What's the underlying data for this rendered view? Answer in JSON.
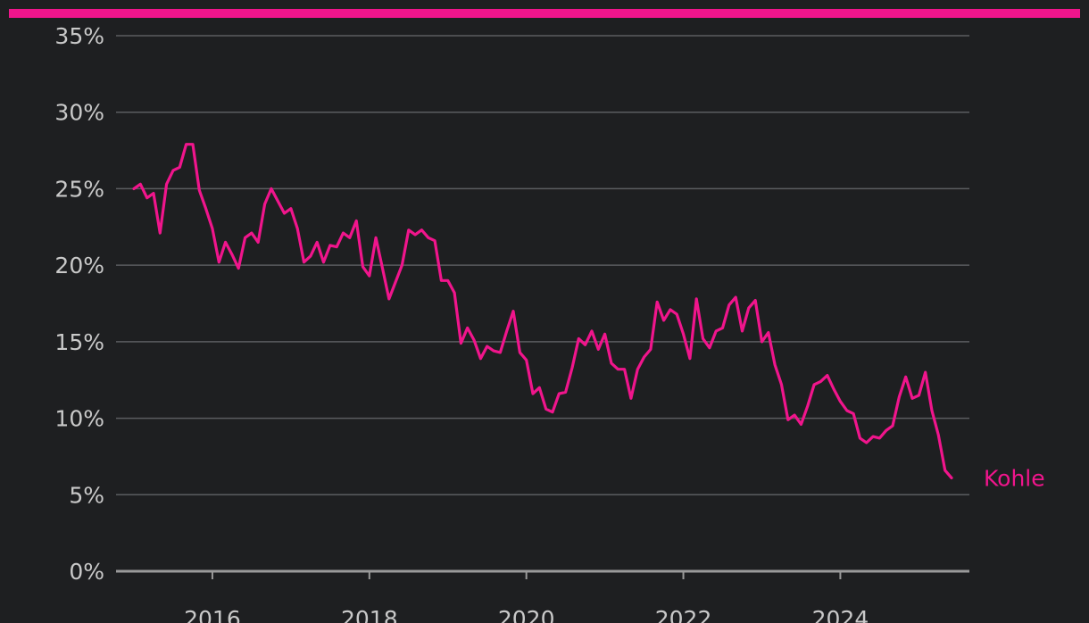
{
  "colors": {
    "background": "#1e1f21",
    "accent": "#f0158c",
    "grid": "#5b5d60",
    "baseline": "#9a9a9a",
    "tick_text": "#c9c9c9"
  },
  "chart_data": {
    "type": "line",
    "title": "",
    "xlabel": "",
    "ylabel": "",
    "ylim": [
      0,
      35
    ],
    "xlim": [
      "2015-01",
      "2025-06"
    ],
    "y_ticks": [
      "0%",
      "5%",
      "10%",
      "15%",
      "20%",
      "25%",
      "30%",
      "35%"
    ],
    "x_ticks": [
      "2016",
      "2018",
      "2020",
      "2022",
      "2024"
    ],
    "grid": true,
    "legend": "direct label at line end",
    "series": [
      {
        "name": "Kohle",
        "x": [
          "2015-01",
          "2015-02",
          "2015-03",
          "2015-04",
          "2015-05",
          "2015-06",
          "2015-07",
          "2015-08",
          "2015-09",
          "2015-10",
          "2015-11",
          "2015-12",
          "2016-01",
          "2016-02",
          "2016-03",
          "2016-04",
          "2016-05",
          "2016-06",
          "2016-07",
          "2016-08",
          "2016-09",
          "2016-10",
          "2016-11",
          "2016-12",
          "2017-01",
          "2017-02",
          "2017-03",
          "2017-04",
          "2017-05",
          "2017-06",
          "2017-07",
          "2017-08",
          "2017-09",
          "2017-10",
          "2017-11",
          "2017-12",
          "2018-01",
          "2018-02",
          "2018-03",
          "2018-04",
          "2018-05",
          "2018-06",
          "2018-07",
          "2018-08",
          "2018-09",
          "2018-10",
          "2018-11",
          "2018-12",
          "2019-01",
          "2019-02",
          "2019-03",
          "2019-04",
          "2019-05",
          "2019-06",
          "2019-07",
          "2019-08",
          "2019-09",
          "2019-10",
          "2019-11",
          "2019-12",
          "2020-01",
          "2020-02",
          "2020-03",
          "2020-04",
          "2020-05",
          "2020-06",
          "2020-07",
          "2020-08",
          "2020-09",
          "2020-10",
          "2020-11",
          "2020-12",
          "2021-01",
          "2021-02",
          "2021-03",
          "2021-04",
          "2021-05",
          "2021-06",
          "2021-07",
          "2021-08",
          "2021-09",
          "2021-10",
          "2021-11",
          "2021-12",
          "2022-01",
          "2022-02",
          "2022-03",
          "2022-04",
          "2022-05",
          "2022-06",
          "2022-07",
          "2022-08",
          "2022-09",
          "2022-10",
          "2022-11",
          "2022-12",
          "2023-01",
          "2023-02",
          "2023-03",
          "2023-04",
          "2023-05",
          "2023-06",
          "2023-07",
          "2023-08",
          "2023-09",
          "2023-10",
          "2023-11",
          "2023-12",
          "2024-01",
          "2024-02",
          "2024-03",
          "2024-04",
          "2024-05",
          "2024-06",
          "2024-07",
          "2024-08",
          "2024-09",
          "2024-10",
          "2024-11",
          "2024-12",
          "2025-01",
          "2025-02",
          "2025-03",
          "2025-04",
          "2025-05",
          "2025-06"
        ],
        "values": [
          25.0,
          25.3,
          24.4,
          24.7,
          22.1,
          25.3,
          26.2,
          26.4,
          27.9,
          27.9,
          24.9,
          23.7,
          22.4,
          20.2,
          21.5,
          20.7,
          19.8,
          21.8,
          22.1,
          21.5,
          24.0,
          25.0,
          24.2,
          23.4,
          23.7,
          22.4,
          20.2,
          20.6,
          21.5,
          20.2,
          21.3,
          21.2,
          22.1,
          21.8,
          22.9,
          19.9,
          19.3,
          21.8,
          19.8,
          17.8,
          18.9,
          20.0,
          22.3,
          22.0,
          22.3,
          21.8,
          21.6,
          19.0,
          19.0,
          18.2,
          14.9,
          15.9,
          15.1,
          13.9,
          14.7,
          14.4,
          14.3,
          15.7,
          17.0,
          14.3,
          13.8,
          11.6,
          12.0,
          10.6,
          10.4,
          11.6,
          11.7,
          13.3,
          15.2,
          14.8,
          15.7,
          14.5,
          15.5,
          13.6,
          13.2,
          13.2,
          11.3,
          13.2,
          14.0,
          14.5,
          17.6,
          16.4,
          17.1,
          16.8,
          15.5,
          13.9,
          17.8,
          15.2,
          14.6,
          15.7,
          15.9,
          17.4,
          17.9,
          15.7,
          17.2,
          17.7,
          15.0,
          15.6,
          13.5,
          12.2,
          9.9,
          10.2,
          9.6,
          10.8,
          12.2,
          12.4,
          12.8,
          11.9,
          11.1,
          10.5,
          10.3,
          8.7,
          8.4,
          8.8,
          8.7,
          9.2,
          9.5,
          11.4,
          12.7,
          11.3,
          11.5,
          13.0,
          10.5,
          8.9,
          6.6,
          6.1
        ]
      }
    ]
  }
}
